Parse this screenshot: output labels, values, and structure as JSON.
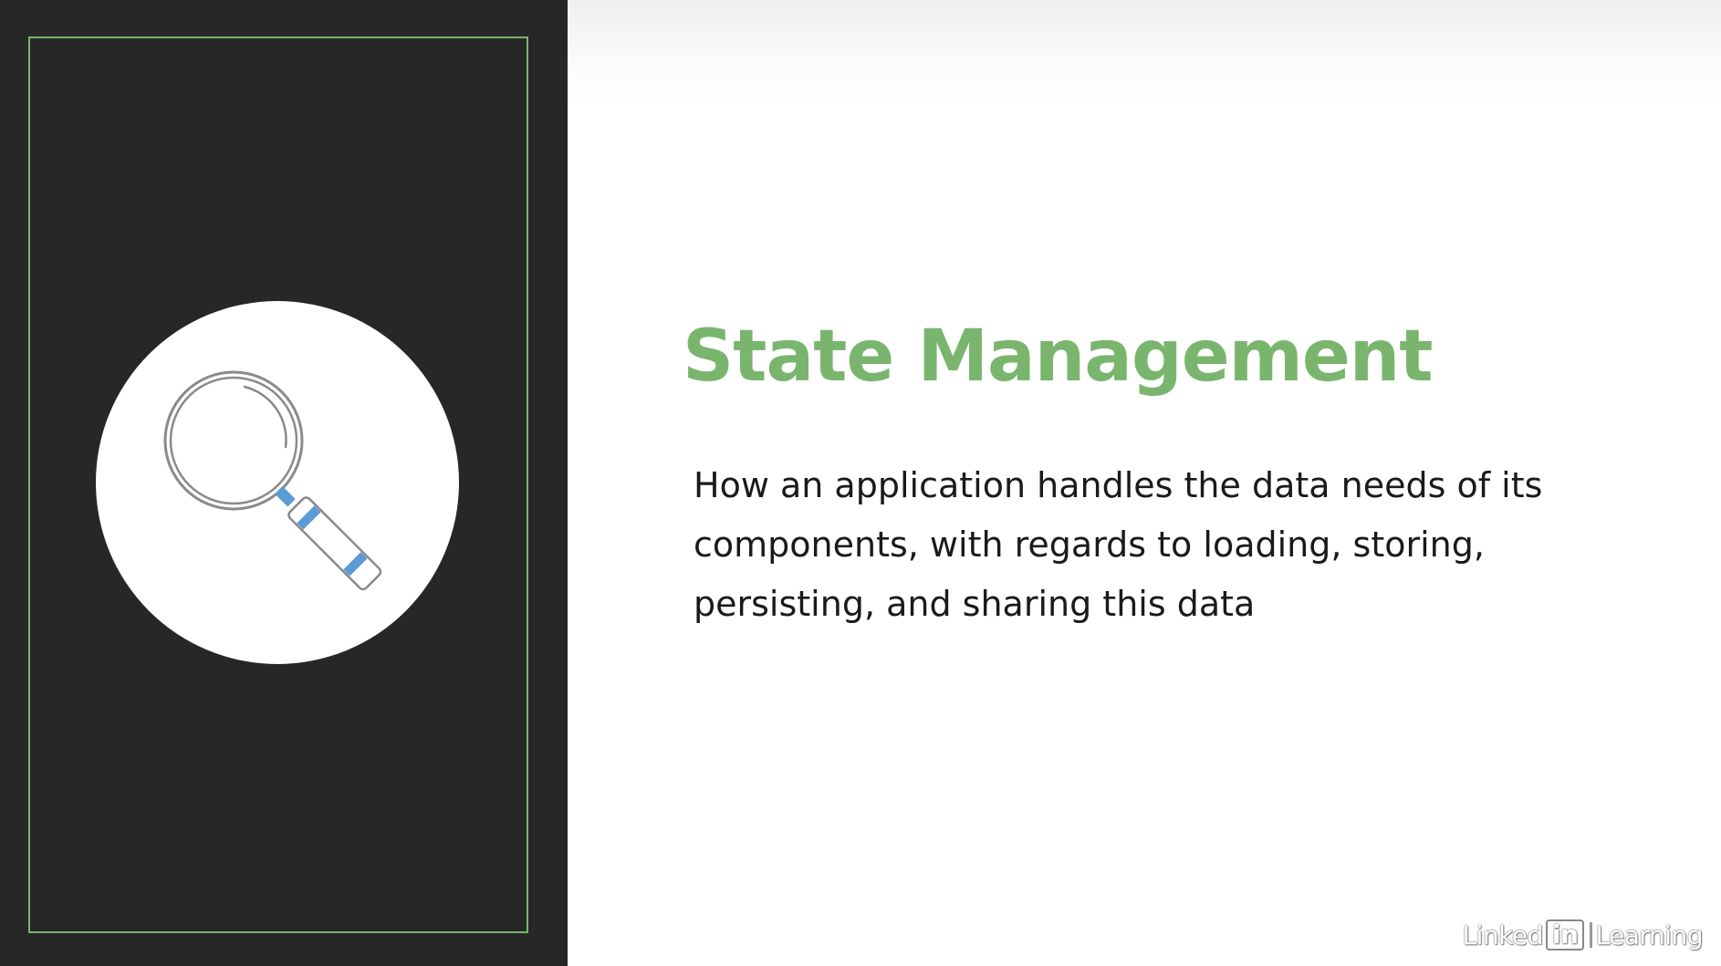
{
  "slide": {
    "title": "State Management",
    "description": "How an application handles the data needs of its components, with regards to loading, storing, persisting, and sharing this data",
    "illustration": "magnifying-glass-icon"
  },
  "watermark": {
    "brand_part1": "Linked",
    "brand_part2": "in",
    "brand_part3": "Learning"
  },
  "colors": {
    "accent": "#7ab56e",
    "panel_background": "#272727",
    "handle_stripe": "#5b9bd5",
    "text": "#1a1a1a"
  }
}
